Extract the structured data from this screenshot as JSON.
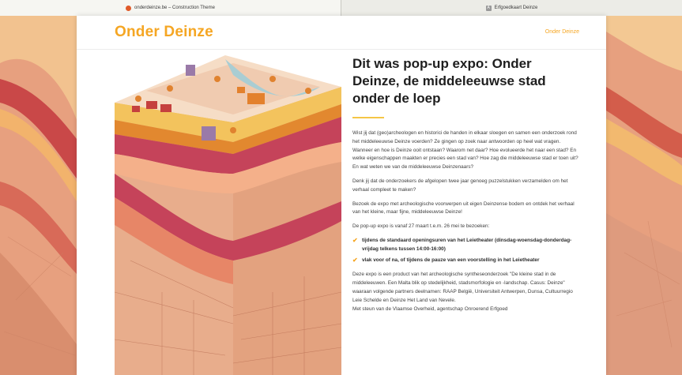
{
  "browser": {
    "tabs": [
      {
        "label": "onderdeinze.be – Construction Theme",
        "active": true
      },
      {
        "label": "Erfgoedkaart Deinze",
        "active": false
      }
    ]
  },
  "header": {
    "logo": "Onder Deinze",
    "nav_link": "Onder Deinze"
  },
  "article": {
    "title": "Dit was pop-up expo: Onder Deinze, de middeleeuwse stad onder de loep",
    "paragraphs": [
      "Wist jij dat (geo)archeologen en historici de handen in elkaar sloegen en samen een onderzoek rond het middeleeuwse Deinze voerden? Ze gingen op zoek naar antwoorden op heel wat vragen. Wanneer en hoe is Deinze ooit ontstaan? Waarom net daar? Hoe evolueerde het naar een stad? En welke eigenschappen maakten er precies een stad van? Hoe zag die middeleeuwse stad er toen uit? En wat weten we van de middeleeuwse Deinzenaars?",
      "Denk jij dat de onderzoekers de afgelopen twee jaar genoeg puzzelstukken verzamelden om het verhaal compleet te maken?",
      "Bezoek de expo met archeologische voorwerpen uit eigen Deinzense bodem en ontdek het verhaal van het kleine, maar fijne, middeleeuwse Deinze!",
      "De pop-up expo is vanaf 27 maart t.e.m. 26 mei te bezoeken:"
    ],
    "checklist": [
      "tijdens de standaard openingsuren van het Leietheater (dinsdag-woensdag-donderdag-vrijdag telkens tussen 14:00-16:00)",
      "vlak voor of na, of tijdens de pauze van een voorstelling in het Leietheater"
    ],
    "footer_paragraphs": [
      "Deze expo is een product van het archeologische syntheseonderzoek \"De kleine stad in de middeleeuwen. Een Malta blik op stedelijkheid, stadsmorfologie en -landschap. Casus: Deinze\" waaraan volgende partners deelnamen: RAAP België, Universiteit Antwerpen, Dunsa, Cultuurregio Leie Schelde en Deinze Het Land van Nevele.",
      "Met steun van de Vlaamse Overheid, agentschap Onroerend Erfgoed"
    ]
  },
  "colors": {
    "brand": "#f5a623",
    "accent_rule": "#f5c646",
    "check": "#f5a623"
  },
  "icons": {
    "check": "✔"
  }
}
